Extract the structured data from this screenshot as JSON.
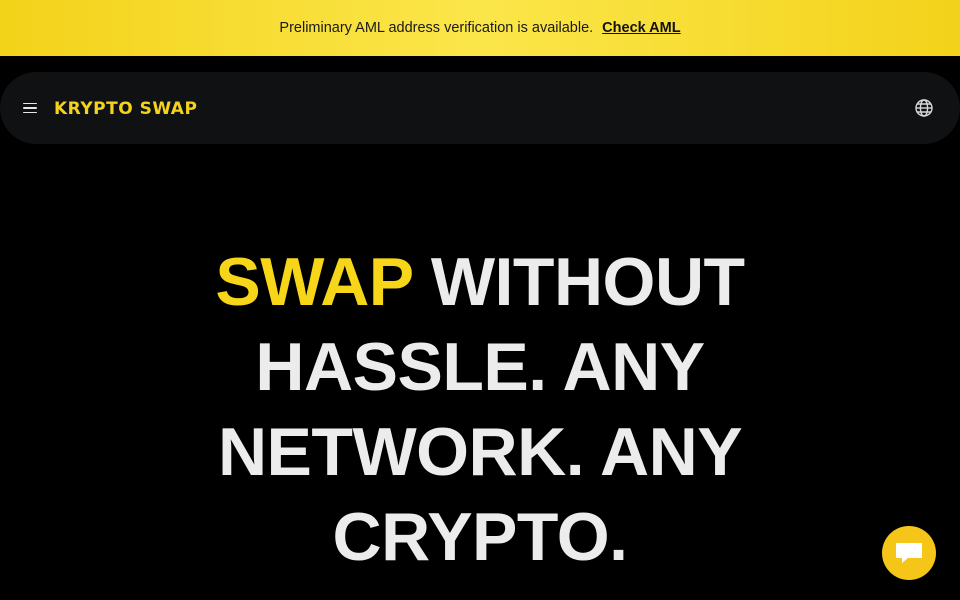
{
  "banner": {
    "message": "Preliminary AML address verification is available.",
    "link_label": "Check AML"
  },
  "header": {
    "logo_text": "KRYPTO SWAP",
    "menu_icon": "hamburger-icon",
    "language_icon": "globe-icon"
  },
  "hero": {
    "accent_word": "SWAP",
    "line1_rest": " WITHOUT",
    "line2": "HASSLE. ANY",
    "line3": "NETWORK. ANY",
    "line4": "CRYPTO."
  },
  "chat": {
    "icon": "chat-icon"
  },
  "colors": {
    "accent": "#f7d619",
    "banner_bg": "#f5d829",
    "page_bg": "#000000",
    "navbar_bg": "#101112",
    "chat_bg": "#f5c518"
  }
}
